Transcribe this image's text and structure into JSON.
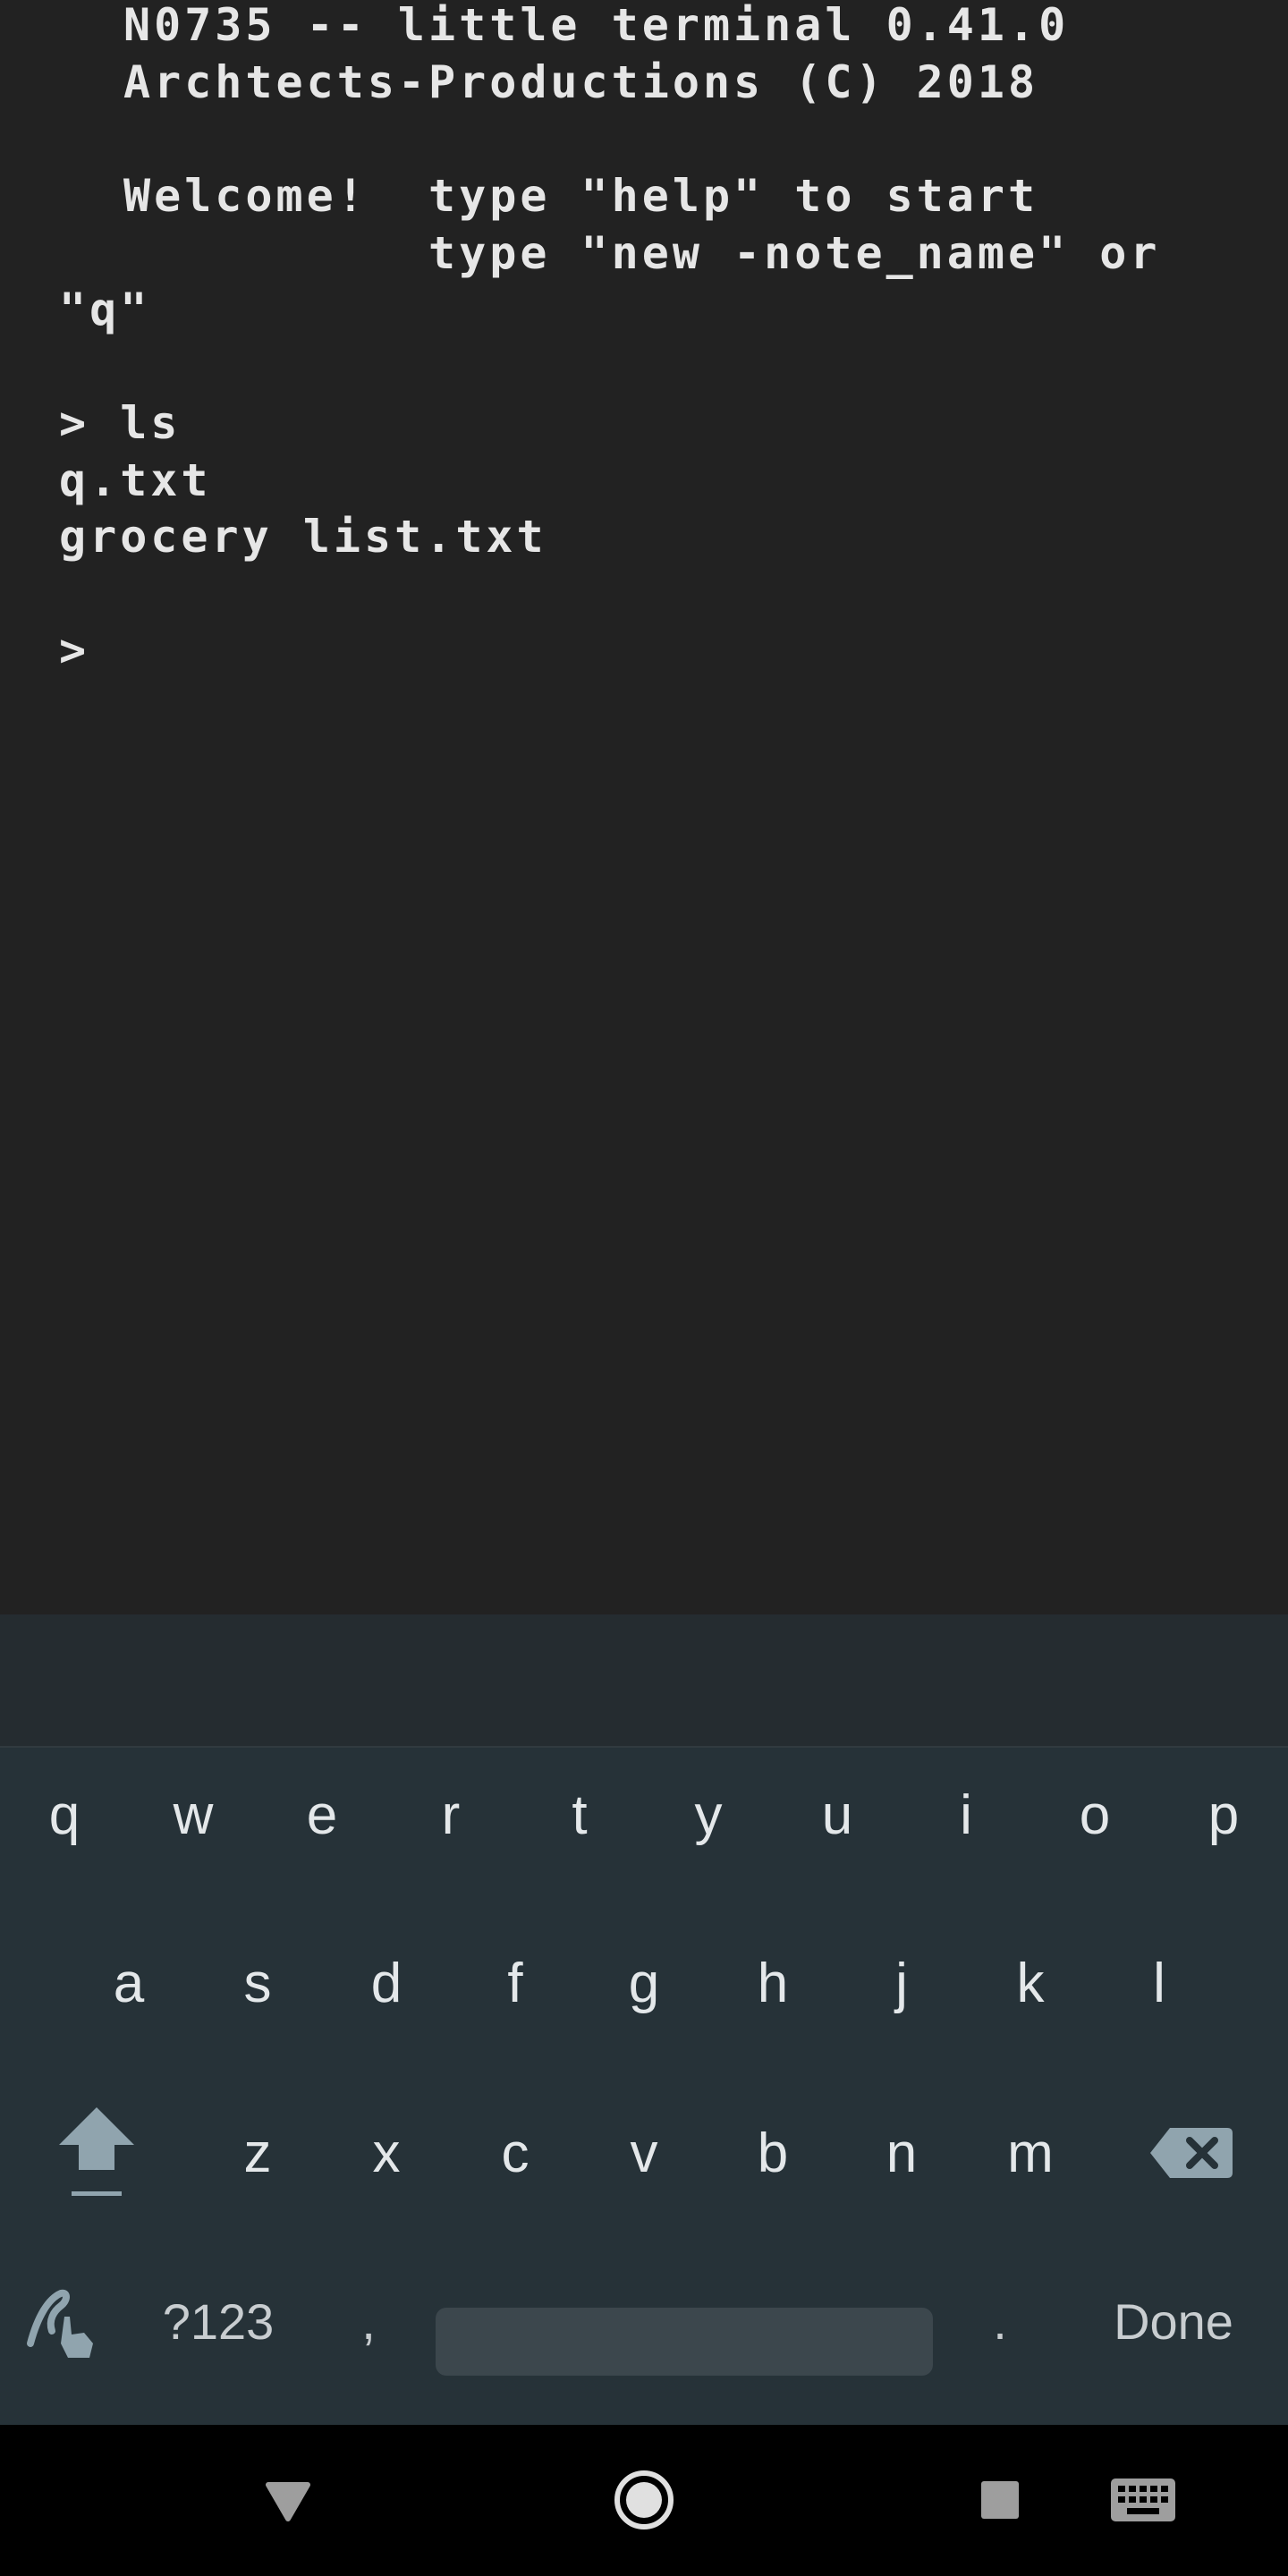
{
  "terminal": {
    "lines": [
      "N0735 -- little terminal 0.41.0",
      "Archtects-Productions (C) 2018",
      "",
      "Welcome!  type \"help\" to start",
      "          type \"new -note_name\" or",
      "\"q\"",
      "",
      "> ls",
      "q.txt",
      "grocery list.txt",
      "",
      ">"
    ]
  },
  "keyboard": {
    "row1": [
      "q",
      "w",
      "e",
      "r",
      "t",
      "y",
      "u",
      "i",
      "o",
      "p"
    ],
    "row2": [
      "a",
      "s",
      "d",
      "f",
      "g",
      "h",
      "j",
      "k",
      "l"
    ],
    "row3": [
      "z",
      "x",
      "c",
      "v",
      "b",
      "n",
      "m"
    ],
    "row4": {
      "symbols_label": "?123",
      "comma": ",",
      "period": ".",
      "done_label": "Done"
    },
    "icons": {
      "shift": "shift-arrow-icon",
      "backspace": "backspace-icon",
      "handwriting": "handwriting-icon"
    }
  },
  "navbar": {
    "icons": [
      "back-triangle-icon",
      "home-circle-icon",
      "recents-square-icon",
      "keyboard-switch-icon"
    ]
  },
  "colors": {
    "terminal_bg": "#222222",
    "terminal_text": "#e6e6e6",
    "keyboard_bg": "#263238",
    "key_text": "#e4e8ea",
    "nav_bg": "#000000"
  }
}
